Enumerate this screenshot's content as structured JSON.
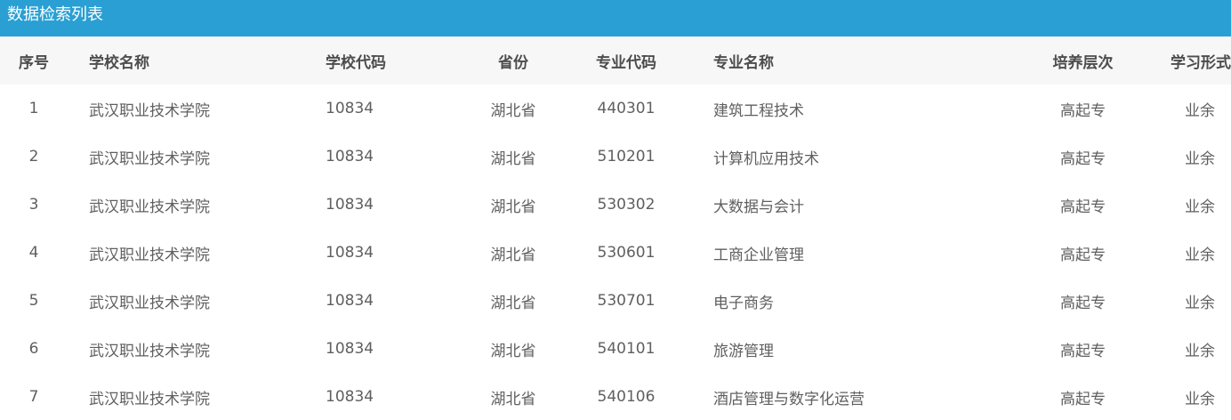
{
  "panel": {
    "title": "数据检索列表"
  },
  "table": {
    "headers": {
      "index": "序号",
      "school_name": "学校名称",
      "school_code": "学校代码",
      "province": "省份",
      "major_code": "专业代码",
      "major_name": "专业名称",
      "level": "培养层次",
      "study_mode": "学习形式"
    },
    "rows": [
      {
        "index": "1",
        "school_name": "武汉职业技术学院",
        "school_code": "10834",
        "province": "湖北省",
        "major_code": "440301",
        "major_name": "建筑工程技术",
        "level": "高起专",
        "study_mode": "业余"
      },
      {
        "index": "2",
        "school_name": "武汉职业技术学院",
        "school_code": "10834",
        "province": "湖北省",
        "major_code": "510201",
        "major_name": "计算机应用技术",
        "level": "高起专",
        "study_mode": "业余"
      },
      {
        "index": "3",
        "school_name": "武汉职业技术学院",
        "school_code": "10834",
        "province": "湖北省",
        "major_code": "530302",
        "major_name": "大数据与会计",
        "level": "高起专",
        "study_mode": "业余"
      },
      {
        "index": "4",
        "school_name": "武汉职业技术学院",
        "school_code": "10834",
        "province": "湖北省",
        "major_code": "530601",
        "major_name": "工商企业管理",
        "level": "高起专",
        "study_mode": "业余"
      },
      {
        "index": "5",
        "school_name": "武汉职业技术学院",
        "school_code": "10834",
        "province": "湖北省",
        "major_code": "530701",
        "major_name": "电子商务",
        "level": "高起专",
        "study_mode": "业余"
      },
      {
        "index": "6",
        "school_name": "武汉职业技术学院",
        "school_code": "10834",
        "province": "湖北省",
        "major_code": "540101",
        "major_name": "旅游管理",
        "level": "高起专",
        "study_mode": "业余"
      },
      {
        "index": "7",
        "school_name": "武汉职业技术学院",
        "school_code": "10834",
        "province": "湖北省",
        "major_code": "540106",
        "major_name": "酒店管理与数字化运营",
        "level": "高起专",
        "study_mode": "业余"
      }
    ]
  }
}
